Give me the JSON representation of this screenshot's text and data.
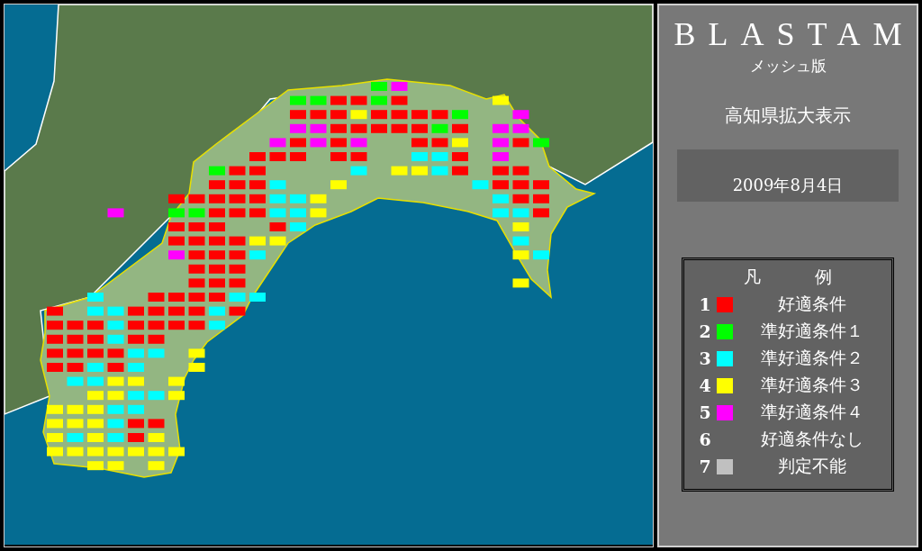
{
  "app": {
    "title": "BLASTAM",
    "subtitle": "メッシュ版",
    "view": "高知県拡大表示",
    "date": "2009年8月4日"
  },
  "legend": {
    "title_left": "凡",
    "title_right": "例",
    "items": [
      {
        "number": "1",
        "label": "好適条件",
        "color": "#ff0000"
      },
      {
        "number": "2",
        "label": "準好適条件１",
        "color": "#00ff00"
      },
      {
        "number": "3",
        "label": "準好適条件２",
        "color": "#00ffff"
      },
      {
        "number": "4",
        "label": "準好適条件３",
        "color": "#ffff00"
      },
      {
        "number": "5",
        "label": "準好適条件４",
        "color": "#ff00ff"
      },
      {
        "number": "6",
        "label": "好適条件なし"
      },
      {
        "number": "7",
        "label": "判定不能",
        "color": "#c0c0c0"
      }
    ]
  }
}
